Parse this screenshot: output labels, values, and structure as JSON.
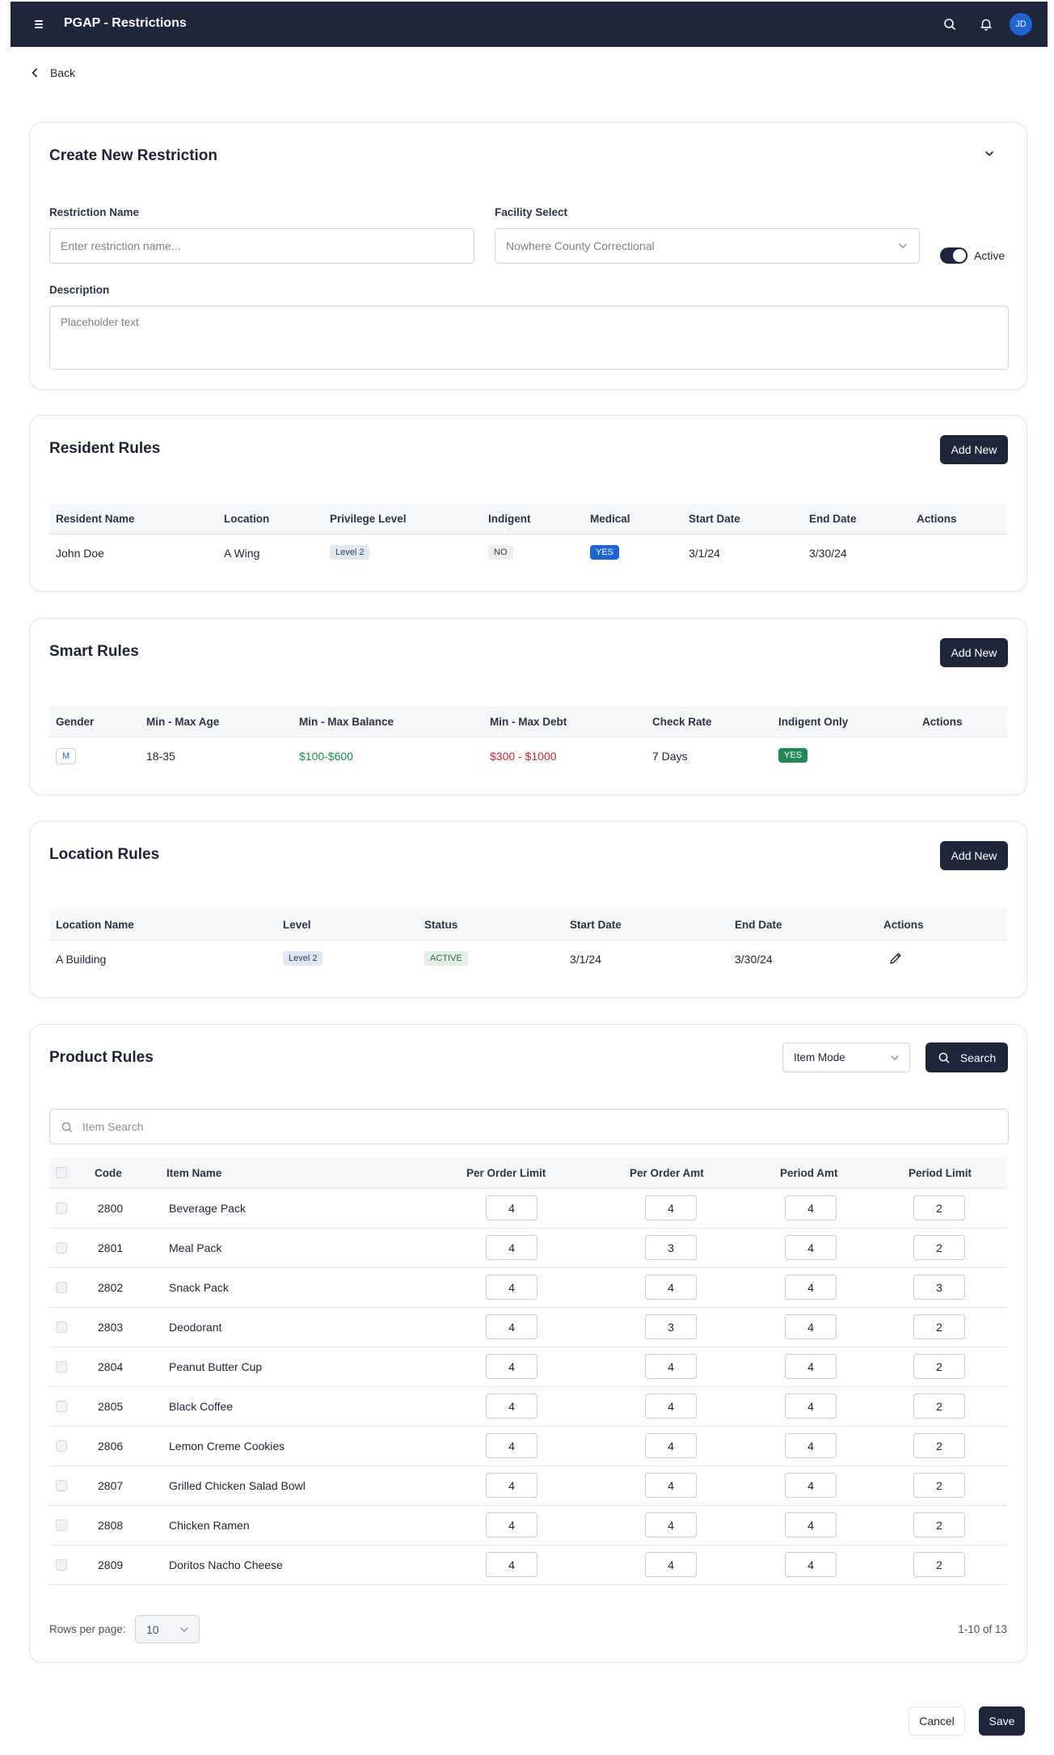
{
  "topbar": {
    "title": "PGAP - Restrictions",
    "avatar_initials": "JD",
    "icons": [
      "menu-icon",
      "search-icon",
      "bell-icon"
    ]
  },
  "back_label": "Back",
  "create": {
    "title": "Create New Restriction",
    "name_label": "Restriction Name",
    "name_placeholder": "Enter restriction name...",
    "facility_label": "Facility Select",
    "facility_value": "Nowhere County Correctional",
    "active_label": "Active",
    "active_on": true,
    "description_label": "Description",
    "description_placeholder": "Placeholder text"
  },
  "resident": {
    "title": "Resident Rules",
    "add_label": "Add New",
    "headers": [
      "Resident Name",
      "Location",
      "Privilege Level",
      "Indigent",
      "Medical",
      "Start Date",
      "End Date",
      "Actions"
    ],
    "row": {
      "name": "John Doe",
      "location": "A Wing",
      "privilege": "Level 2",
      "indigent": "NO",
      "medical": "YES",
      "start": "3/1/24",
      "end": "3/30/24"
    }
  },
  "smart": {
    "title": "Smart Rules",
    "add_label": "Add New",
    "headers": [
      "Gender",
      "Min - Max Age",
      "Min - Max Balance",
      "Min - Max Debt",
      "Check Rate",
      "Indigent Only",
      "Actions"
    ],
    "row": {
      "gender": "M",
      "age": "18-35",
      "balance": "$100-$600",
      "debt": "$300 - $1000",
      "rate": "7 Days",
      "indigent_only": "YES"
    }
  },
  "location": {
    "title": "Location Rules",
    "add_label": "Add New",
    "headers": [
      "Location Name",
      "Level",
      "Status",
      "Start Date",
      "End Date",
      "Actions"
    ],
    "row": {
      "name": "A Building",
      "level": "Level 2",
      "status": "ACTIVE",
      "start": "3/1/24",
      "end": "3/30/24"
    }
  },
  "product": {
    "title": "Product Rules",
    "mode_value": "Item Mode",
    "search_label": "Search",
    "item_search_placeholder": "Item Search",
    "headers": [
      "Code",
      "Item Name",
      "Per Order Limit",
      "Per Order Amt",
      "Period Amt",
      "Period Limit"
    ],
    "rows": [
      {
        "code": "2800",
        "name": "Beverage Pack",
        "pol": "4",
        "poa": "4",
        "pa": "4",
        "pl": "2"
      },
      {
        "code": "2801",
        "name": "Meal Pack",
        "pol": "4",
        "poa": "3",
        "pa": "4",
        "pl": "2"
      },
      {
        "code": "2802",
        "name": "Snack Pack",
        "pol": "4",
        "poa": "4",
        "pa": "4",
        "pl": "3"
      },
      {
        "code": "2803",
        "name": "Deodorant",
        "pol": "4",
        "poa": "3",
        "pa": "4",
        "pl": "2"
      },
      {
        "code": "2804",
        "name": "Peanut Butter Cup",
        "pol": "4",
        "poa": "4",
        "pa": "4",
        "pl": "2"
      },
      {
        "code": "2805",
        "name": "Black Coffee",
        "pol": "4",
        "poa": "4",
        "pa": "4",
        "pl": "2"
      },
      {
        "code": "2806",
        "name": "Lemon Creme Cookies",
        "pol": "4",
        "poa": "4",
        "pa": "4",
        "pl": "2"
      },
      {
        "code": "2807",
        "name": "Grilled Chicken Salad Bowl",
        "pol": "4",
        "poa": "4",
        "pa": "4",
        "pl": "2"
      },
      {
        "code": "2808",
        "name": "Chicken Ramen",
        "pol": "4",
        "poa": "4",
        "pa": "4",
        "pl": "2"
      },
      {
        "code": "2809",
        "name": "Doritos Nacho Cheese",
        "pol": "4",
        "poa": "4",
        "pa": "4",
        "pl": "2"
      }
    ],
    "rows_per_page_label": "Rows per page:",
    "rows_per_page_value": "10",
    "range_text": "1-10 of 13"
  },
  "footer": {
    "cancel_label": "Cancel",
    "save_label": "Save"
  },
  "colors": {
    "navy": "#1e263b",
    "blue": "#1b66d4",
    "green": "#1f8a55",
    "red": "#d6202f"
  }
}
